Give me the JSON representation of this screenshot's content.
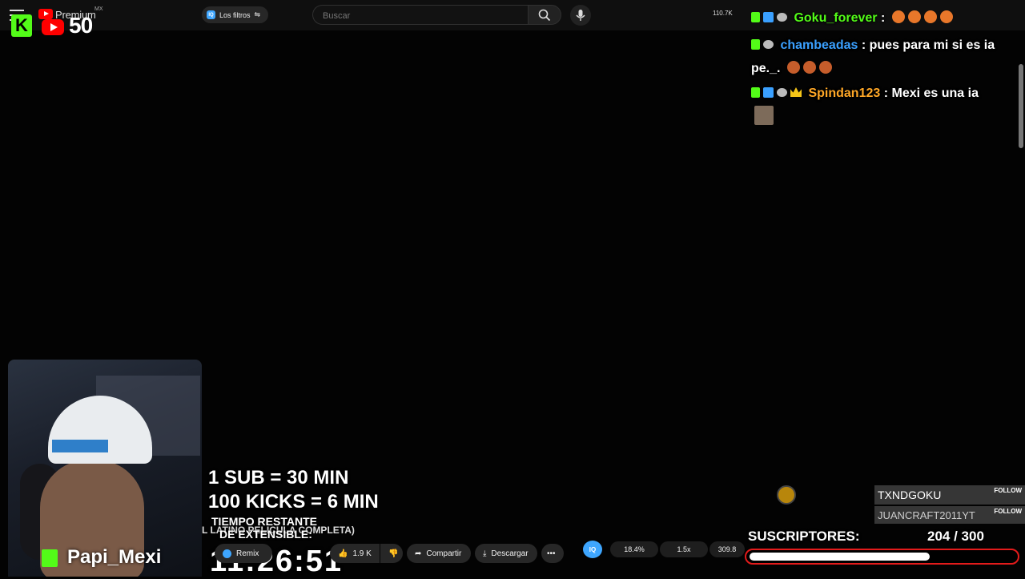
{
  "topbar": {
    "premium_label": "Premium",
    "region": "MX",
    "filter_chip_label": "Los filtros",
    "search_placeholder": "Buscar",
    "viewers": "110.7K"
  },
  "overlay": {
    "yt_number": "50"
  },
  "chat": {
    "messages": [
      {
        "user": "Goku_forever",
        "user_color": "#53fc18",
        "text": ":"
      },
      {
        "user": "chambeadas",
        "user_color": "#3aa0ff",
        "text": ": pues para mi si es ia",
        "cont": "pe._."
      },
      {
        "user": "Spindan123",
        "user_color": "#ffa726",
        "text": ": Mexi es una ia"
      }
    ]
  },
  "webcam": {
    "streamer_name": "Papi_Mexi"
  },
  "goal": {
    "line1": "1 SUB = 30 MIN",
    "line2": "100 KICKS = 6 MIN",
    "remaining_line1": "TIEMPO RESTANTE",
    "remaining_line2": "DE EXTENSIBLE:",
    "timer": "11:26:51",
    "video_title": "L LATINO PELICULA COMPLETA)"
  },
  "actions": {
    "remix": "Remix",
    "likes": "1.9 K",
    "share": "Compartir",
    "download": "Descargar",
    "iq_label": "IQ",
    "stat1": "18.4%",
    "stat2": "1.5x",
    "stat3": "309.8"
  },
  "follows": [
    {
      "name": "TXNDGOKU",
      "button": "FOLLOW"
    },
    {
      "name": "JUANCRAFT2011YT",
      "button": "FOLLOW"
    }
  ],
  "subs": {
    "label": "SUSCRIPTORES:",
    "count": "204  / 300",
    "current": 204,
    "target": 300
  }
}
